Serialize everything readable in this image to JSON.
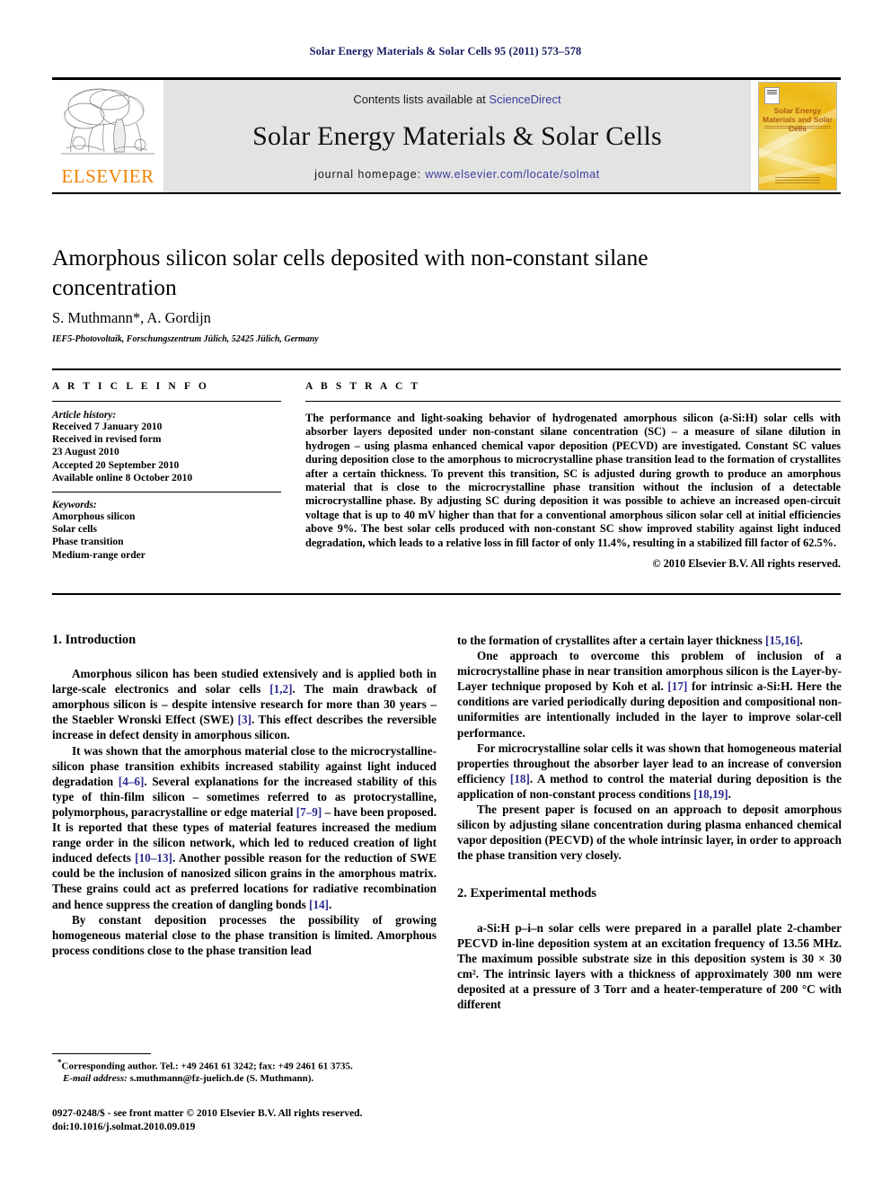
{
  "running_head": "Solar Energy Materials & Solar Cells 95 (2011) 573–578",
  "masthead": {
    "contents_prefix": "Contents lists available at ",
    "sciencedirect_link": "ScienceDirect",
    "journal_title": "Solar Energy Materials & Solar Cells",
    "homepage_prefix": "journal homepage: ",
    "homepage_link": "www.elsevier.com/locate/solmat",
    "publisher_wordmark": "ELSEVIER",
    "publisher_color": "#ef8200",
    "link_color": "#3b3b9e",
    "band_background": "#e3e3e3",
    "cover_title": "Solar Energy Materials and Solar Cells"
  },
  "article": {
    "title": "Amorphous silicon solar cells deposited with non-constant silane concentration",
    "authors": "S. Muthmann*, A. Gordijn",
    "affiliation": "IEF5-Photovoltaik, Forschungszentrum Jülich, 52425 Jülich, Germany"
  },
  "article_info": {
    "label": "A R T I C L E    I N F O",
    "history_heading": "Article history:",
    "history_lines": [
      "Received 7 January 2010",
      "Received in revised form",
      "23 August 2010",
      "Accepted 20 September 2010",
      "Available online 8 October 2010"
    ],
    "keywords_heading": "Keywords:",
    "keywords": [
      "Amorphous silicon",
      "Solar cells",
      "Phase transition",
      "Medium-range order"
    ]
  },
  "abstract": {
    "label": "A B S T R A C T",
    "text": "The performance and light-soaking behavior of hydrogenated amorphous silicon (a-Si:H) solar cells with absorber layers deposited under non-constant silane concentration (SC) – a measure of silane dilution in hydrogen – using plasma enhanced chemical vapor deposition (PECVD) are investigated. Constant SC values during deposition close to the amorphous to microcrystalline phase transition lead to the formation of crystallites after a certain thickness. To prevent this transition, SC is adjusted during growth to produce an amorphous material that is close to the microcrystalline phase transition without the inclusion of a detectable microcrystalline phase. By adjusting SC during deposition it was possible to achieve an increased open-circuit voltage that is up to 40 mV higher than that for a conventional amorphous silicon solar cell at initial efficiencies above 9%. The best solar cells produced with non-constant SC show improved stability against light induced degradation, which leads to a relative loss in fill factor of only 11.4%, resulting in a stabilized fill factor of 62.5%.",
    "copyright": "© 2010 Elsevier B.V. All rights reserved."
  },
  "sections": {
    "introduction_heading": "1.  Introduction",
    "experimental_heading": "2.  Experimental methods"
  },
  "body": {
    "left": [
      "Amorphous silicon has been studied extensively and is applied both in large-scale electronics and solar cells [1,2]. The main drawback of amorphous silicon is – despite intensive research for more than 30 years – the Staebler Wronski Effect (SWE) [3]. This effect describes the reversible increase in defect density in amorphous silicon.",
      "It was shown that the amorphous material close to the microcrystalline-silicon phase transition exhibits increased stability against light induced degradation [4–6]. Several explanations for the increased stability of this type of thin-film silicon – sometimes referred to as protocrystalline, polymorphous, paracrystalline or edge material [7–9] – have been proposed. It is reported that these types of material features increased the medium range order in the silicon network, which led to reduced creation of light induced defects [10–13]. Another possible reason for the reduction of SWE could be the inclusion of nanosized silicon grains in the amorphous matrix. These grains could act as preferred locations for radiative recombination and hence suppress the creation of dangling bonds [14].",
      "By constant deposition processes the possibility of growing homogeneous material close to the phase transition is limited. Amorphous process conditions close to the phase transition lead"
    ],
    "right": [
      "to the formation of crystallites after a certain layer thickness [15,16].",
      "One approach to overcome this problem of inclusion of a microcrystalline phase in near transition amorphous silicon is the Layer-by-Layer technique proposed by Koh et al. [17] for intrinsic a-Si:H. Here the conditions are varied periodically during deposition and compositional non-uniformities are intentionally included in the layer to improve solar-cell performance.",
      "For microcrystalline solar cells it was shown that homogeneous material properties throughout the absorber layer lead to an increase of conversion efficiency [18]. A method to control the material during deposition is the application of non-constant process conditions [18,19].",
      "The present paper is focused on an approach to deposit amorphous silicon by adjusting silane concentration during plasma enhanced chemical vapor deposition (PECVD) of the whole intrinsic layer, in order to approach the phase transition very closely."
    ],
    "experimental": [
      "a-Si:H p–i–n solar cells were prepared in a parallel plate 2-chamber PECVD in-line deposition system at an excitation frequency of 13.56 MHz. The maximum possible substrate size in this deposition system is 30 × 30 cm². The intrinsic layers with a thickness of approximately 300 nm were deposited at a pressure of 3 Torr and a heater-temperature of 200 °C with different"
    ]
  },
  "footnote": {
    "corresponding": "Corresponding author. Tel.: +49 2461 61 3242; fax: +49 2461 61 3735.",
    "email_label": "E-mail address:",
    "email": "s.muthmann@fz-juelich.de (S. Muthmann)."
  },
  "imprint": {
    "line1": "0927-0248/$ - see front matter © 2010 Elsevier B.V. All rights reserved.",
    "line2": "doi:10.1016/j.solmat.2010.09.019"
  }
}
